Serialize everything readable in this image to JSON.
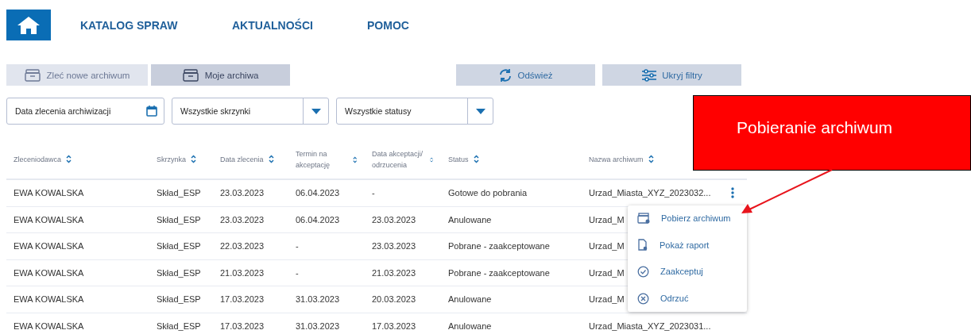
{
  "nav": {
    "items": [
      "KATALOG SPRAW",
      "AKTUALNOŚCI",
      "POMOC"
    ]
  },
  "tabs": [
    {
      "label": "Zleć nowe archiwum",
      "selected": false
    },
    {
      "label": "Moje archiwa",
      "selected": true
    }
  ],
  "actions": [
    {
      "label": "Odśwież",
      "kind": "refresh"
    },
    {
      "label": "Ukryj filtry",
      "kind": "filters"
    }
  ],
  "filters": [
    {
      "kind": "date",
      "value": "Data zlecenia archiwizacji"
    },
    {
      "kind": "select",
      "value": "Wszystkie skrzynki"
    },
    {
      "kind": "select",
      "value": "Wszystkie statusy"
    }
  ],
  "table": {
    "columns": [
      "Zleceniodawca",
      "Skrzynka",
      "Data zlecenia",
      "Termin na akceptację",
      "Data akceptacji/ odrzucenia",
      "Status",
      "Nazwa archiwum"
    ],
    "rows": [
      {
        "cells": [
          "EWA KOWALSKA",
          "Skład_ESP",
          "23.03.2023",
          "06.04.2023",
          "-",
          "Gotowe do pobrania",
          "Urzad_Miasta_XYZ_2023032..."
        ],
        "menu": true
      },
      {
        "cells": [
          "EWA KOWALSKA",
          "Skład_ESP",
          "23.03.2023",
          "06.04.2023",
          "23.03.2023",
          "Anulowane",
          "Urzad_M"
        ],
        "menu": false
      },
      {
        "cells": [
          "EWA KOWALSKA",
          "Skład_ESP",
          "22.03.2023",
          "-",
          "23.03.2023",
          "Pobrane - zaakceptowane",
          "Urzad_M"
        ],
        "menu": false
      },
      {
        "cells": [
          "EWA KOWALSKA",
          "Skład_ESP",
          "21.03.2023",
          "-",
          "21.03.2023",
          "Pobrane - zaakceptowane",
          "Urzad_M"
        ],
        "menu": false
      },
      {
        "cells": [
          "EWA KOWALSKA",
          "Skład_ESP",
          "17.03.2023",
          "31.03.2023",
          "20.03.2023",
          "Anulowane",
          "Urzad_M"
        ],
        "menu": false
      },
      {
        "cells": [
          "EWA KOWALSKA",
          "Skład_ESP",
          "17.03.2023",
          "31.03.2023",
          "17.03.2023",
          "Anulowane",
          "Urzad_Miasta_XYZ_2023031..."
        ],
        "menu": false
      }
    ]
  },
  "context_menu": [
    {
      "label": "Pobierz archiwum",
      "kind": "download"
    },
    {
      "label": "Pokaż raport",
      "kind": "report"
    },
    {
      "label": "Zaakceptuj",
      "kind": "accept"
    },
    {
      "label": "Odrzuć",
      "kind": "reject"
    }
  ],
  "callout": {
    "text": "Pobieranie archiwum"
  }
}
